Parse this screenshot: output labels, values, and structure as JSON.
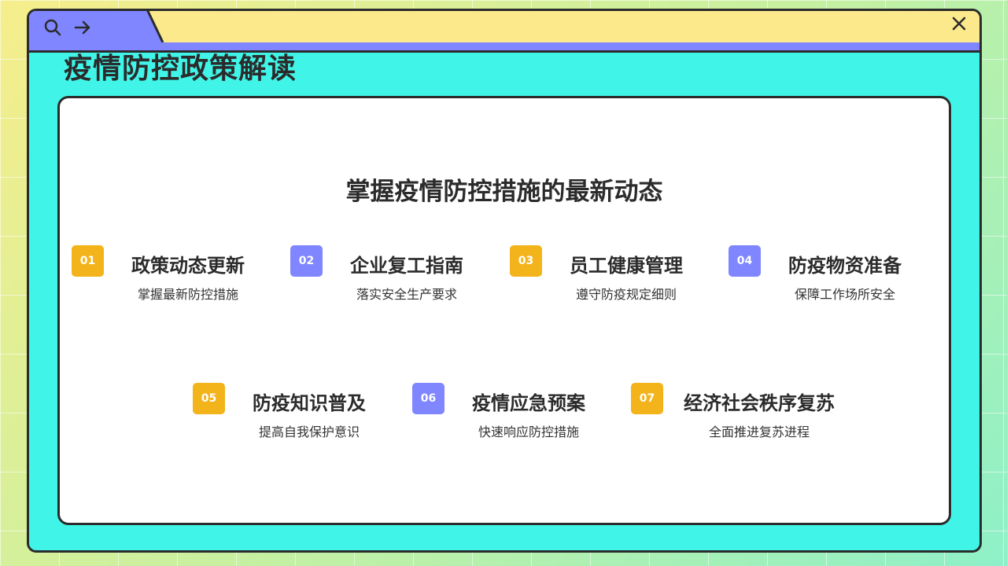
{
  "window": {
    "nav_icons": [
      "search-icon",
      "arrow-right-icon"
    ],
    "close_icon": "close-icon",
    "colors": {
      "accent_purple": "#7f86ff",
      "accent_yellow": "#f3b41b",
      "window_bg": "#40f5e8",
      "titlebar_bg": "#fbe98c"
    }
  },
  "page_title": "疫情防控政策解读",
  "heading": "掌握疫情防控措施的最新动态",
  "items": [
    {
      "number": "01",
      "title": "政策动态更新",
      "subtitle": "掌握最新防控措施",
      "color": "yellow"
    },
    {
      "number": "02",
      "title": "企业复工指南",
      "subtitle": "落实安全生产要求",
      "color": "purple"
    },
    {
      "number": "03",
      "title": "员工健康管理",
      "subtitle": "遵守防疫规定细则",
      "color": "yellow"
    },
    {
      "number": "04",
      "title": "防疫物资准备",
      "subtitle": "保障工作场所安全",
      "color": "purple"
    },
    {
      "number": "05",
      "title": "防疫知识普及",
      "subtitle": "提高自我保护意识",
      "color": "yellow"
    },
    {
      "number": "06",
      "title": "疫情应急预案",
      "subtitle": "快速响应防控措施",
      "color": "purple"
    },
    {
      "number": "07",
      "title": "经济社会秩序复苏",
      "subtitle": "全面推进复苏进程",
      "color": "yellow"
    }
  ]
}
